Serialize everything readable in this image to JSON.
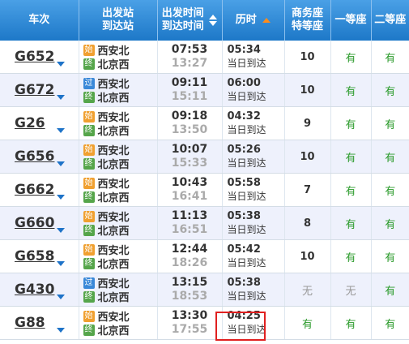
{
  "header": {
    "train": "车次",
    "station_line1": "出发站",
    "station_line2": "到达站",
    "time_line1": "出发时间",
    "time_line2": "到达时间",
    "duration": "历时",
    "business_line1": "商务座",
    "business_line2": "特等座",
    "first": "一等座",
    "second": "二等座"
  },
  "accent_colors": {
    "header": "#1d78c8",
    "sort_active": "#ff8c1a",
    "available": "#2a9a2a",
    "highlight": "#e02020"
  },
  "rows": [
    {
      "train": "G652",
      "from_badge": "始",
      "from": "西安北",
      "to_badge": "终",
      "to": "北京西",
      "dep": "07:53",
      "arr": "13:27",
      "dur": "05:34",
      "note": "当日到达",
      "business": "10",
      "first": "有",
      "second": "有"
    },
    {
      "train": "G672",
      "from_badge": "过",
      "from": "西安北",
      "to_badge": "终",
      "to": "北京西",
      "dep": "09:11",
      "arr": "15:11",
      "dur": "06:00",
      "note": "当日到达",
      "business": "10",
      "first": "有",
      "second": "有"
    },
    {
      "train": "G26",
      "from_badge": "始",
      "from": "西安北",
      "to_badge": "终",
      "to": "北京西",
      "dep": "09:18",
      "arr": "13:50",
      "dur": "04:32",
      "note": "当日到达",
      "business": "9",
      "first": "有",
      "second": "有"
    },
    {
      "train": "G656",
      "from_badge": "始",
      "from": "西安北",
      "to_badge": "终",
      "to": "北京西",
      "dep": "10:07",
      "arr": "15:33",
      "dur": "05:26",
      "note": "当日到达",
      "business": "10",
      "first": "有",
      "second": "有"
    },
    {
      "train": "G662",
      "from_badge": "始",
      "from": "西安北",
      "to_badge": "终",
      "to": "北京西",
      "dep": "10:43",
      "arr": "16:41",
      "dur": "05:58",
      "note": "当日到达",
      "business": "7",
      "first": "有",
      "second": "有"
    },
    {
      "train": "G660",
      "from_badge": "始",
      "from": "西安北",
      "to_badge": "终",
      "to": "北京西",
      "dep": "11:13",
      "arr": "16:51",
      "dur": "05:38",
      "note": "当日到达",
      "business": "8",
      "first": "有",
      "second": "有"
    },
    {
      "train": "G658",
      "from_badge": "始",
      "from": "西安北",
      "to_badge": "终",
      "to": "北京西",
      "dep": "12:44",
      "arr": "18:26",
      "dur": "05:42",
      "note": "当日到达",
      "business": "10",
      "first": "有",
      "second": "有"
    },
    {
      "train": "G430",
      "from_badge": "过",
      "from": "西安北",
      "to_badge": "终",
      "to": "北京西",
      "dep": "13:15",
      "arr": "18:53",
      "dur": "05:38",
      "note": "当日到达",
      "business": "无",
      "first": "无",
      "second": "有"
    },
    {
      "train": "G88",
      "from_badge": "始",
      "from": "西安北",
      "to_badge": "终",
      "to": "北京西",
      "dep": "13:30",
      "arr": "17:55",
      "dur": "04:25",
      "note": "当日到达",
      "business": "有",
      "first": "有",
      "second": "有"
    }
  ]
}
